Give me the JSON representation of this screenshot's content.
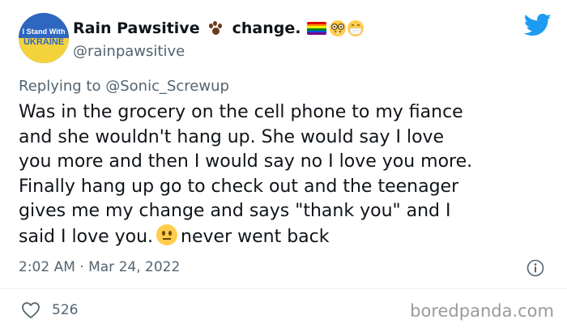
{
  "user": {
    "display_name": "Rain Pawsitive",
    "name_suffix": "change.",
    "handle": "@rainpawsitive",
    "avatar_text": {
      "line1": "I Stand With",
      "line2": "UKRAINE"
    }
  },
  "icons": {
    "paw": "paw-prints-icon",
    "flag": "rainbow-flag-icon",
    "nerd": "nerd-face-icon",
    "mask": "face-with-mask-icon",
    "bird": "twitter-bird-icon",
    "neutral": "neutral-face-icon",
    "info": "info-icon",
    "heart": "heart-icon"
  },
  "reply": {
    "prefix": "Replying to",
    "mention": "@Sonic_Screwup"
  },
  "tweet": {
    "lines": [
      "Was in the grocery on the cell phone to my fiance",
      "and she wouldn't hang up. She would say I love",
      "you more and then I would say no I love you more.",
      "Finally hang up go to check out and the teenager",
      "gives me my change and says \"thank you\" and I"
    ],
    "last_line_before": "said I love you.",
    "last_line_after": "never went back",
    "timestamp": "2:02 AM · Mar 24, 2022"
  },
  "stats": {
    "likes": "526"
  },
  "watermark": "boredpanda.com",
  "colors": {
    "twitter_blue": "#1d9bf0",
    "secondary_text": "#536471",
    "primary_text": "#0f1419"
  }
}
